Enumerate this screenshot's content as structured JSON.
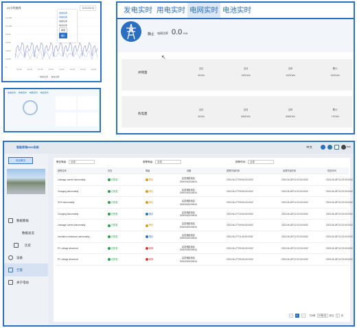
{
  "panel_a": {
    "title": "24小时曲线",
    "date": "2023/08/16",
    "menu": [
      "发电功率",
      "用电功率",
      "电网功率",
      "电池功率"
    ],
    "menu_reset": "重置",
    "menu_ok": "确认",
    "legend": [
      "用电功率",
      "发电功率"
    ],
    "y_ticks": [
      "12,000",
      "10,000",
      "8,000",
      "6,000",
      "4,000",
      "2,000",
      "0"
    ],
    "x_ticks": [
      "01:00",
      "04:00",
      "07:00",
      "10:00",
      "13:00",
      "16:00",
      "19:00",
      "22:00"
    ]
  },
  "panel_b": {
    "tabs": [
      "发电实时",
      "用电实时",
      "电网实时",
      "电池实时"
    ]
  },
  "grid_panel": {
    "tabs": [
      "发电实时",
      "用电实时",
      "电网实时",
      "电池实时"
    ],
    "active_tab": 2,
    "status": "静止",
    "power_label": "电网功率",
    "power_value": "0.0",
    "power_unit": "KW",
    "col_headers": [
      "当日",
      "当月",
      "当年",
      "累计"
    ],
    "rows": [
      {
        "label": "并网量",
        "values": [
          "0KWh",
          "192KWh",
          "192KWh",
          "192KWh"
        ]
      },
      {
        "label": "购电量",
        "values": [
          "0KWh",
          "896KWh",
          "896KWh",
          "17KWh"
        ]
      }
    ]
  },
  "alarm_page": {
    "app_name": "智能家储EMS系统",
    "language": "中文",
    "user": "test",
    "sidebar": {
      "home": "电站概况",
      "items": [
        "数据看板",
        "数据总览",
        "设备",
        "告警",
        "关于电站"
      ]
    },
    "filters": {
      "level_label": "警告等级:",
      "level_value": "全部",
      "status_label": "报警等级:",
      "status_value": "全部",
      "time_label": "报警时间:",
      "time_value": "全部"
    },
    "columns": [
      "报警名称",
      "状态",
      "等级",
      "设备",
      "报警开始时间",
      "处理开始时间",
      "恢复时间"
    ],
    "rows": [
      {
        "name": "Leakage current abnormality",
        "status": "已恢复",
        "status_c": "g",
        "level": "警告",
        "level_c": "o",
        "device": "启发储能电站\nSN00000000M16",
        "start": "2023-06-27T09:45:00.000Z",
        "proc": "2023-06-28T12:22:00.000Z",
        "rec": "2023-06-28T12:22:00.000Z"
      },
      {
        "name": "Charging abnormality",
        "status": "已恢复",
        "status_c": "g",
        "level": "警告",
        "level_c": "o",
        "device": "启发储能电站\nSN00000000M16",
        "start": "2023-06-27T09:45:00.000Z",
        "proc": "2023-06-28T12:22:00.000Z",
        "rec": "2023-06-28T12:22:00.000Z"
      },
      {
        "name": "SOH abnormality",
        "status": "已恢复",
        "status_c": "g",
        "level": "警告",
        "level_c": "o",
        "device": "启发储能电站\nSN00000000M16",
        "start": "2023-06-27T09:45:00.000Z",
        "proc": "2023-06-28T12:22:00.000Z",
        "rec": "2023-06-28T12:22:00.000Z"
      },
      {
        "name": "Charging abnormality",
        "status": "已恢复",
        "status_c": "g",
        "level": "提示",
        "level_c": "b",
        "device": "启发储能电站\nSN00000000M16",
        "start": "2023-06-27T10:45:00.000Z",
        "proc": "2023-06-28T12:22:00.000Z",
        "rec": "2023-06-28T12:22:00.000Z"
      },
      {
        "name": "Leakage current abnormality",
        "status": "已恢复",
        "status_c": "g",
        "level": "警告",
        "level_c": "o",
        "device": "启发储能电站\nSN00000000M16",
        "start": "2023-06-27T09:45:00.000Z",
        "proc": "2023-06-28T12:22:00.000Z",
        "rec": "2023-06-28T12:22:00.000Z"
      },
      {
        "name": "Insulation resistance abnormality",
        "status": "已恢复",
        "status_c": "g",
        "level": "提示",
        "level_c": "b",
        "device": "启发储能电站\nSN00000000M16",
        "start": "2023-06-27T11:45:00.000Z",
        "proc": "2023-06-28T12:22:00.000Z",
        "rec": "2023-06-28T12:22:00.000Z"
      },
      {
        "name": "PV voltage abnormal",
        "status": "已恢复",
        "status_c": "g",
        "level": "故障",
        "level_c": "r",
        "device": "启发储能电站\nSN00000000M16",
        "start": "2023-06-27T09:45:00.000Z",
        "proc": "2023-06-28T12:22:00.000Z",
        "rec": "2023-06-28T12:22:00.000Z"
      },
      {
        "name": "PV voltage abnormal",
        "status": "已恢复",
        "status_c": "g",
        "level": "故障",
        "level_c": "r",
        "device": "启发储能电站\nSN00000000M16",
        "start": "2023-06-27T09:45:00.000Z",
        "proc": "2023-06-28T12:22:00.000Z",
        "rec": "2023-06-28T12:22:00.000Z"
      }
    ],
    "pager": {
      "total": "共8条",
      "current": "1",
      "per_page": "10条/页",
      "goto_label": "前往",
      "goto_page": "1",
      "page_unit": "页"
    }
  }
}
